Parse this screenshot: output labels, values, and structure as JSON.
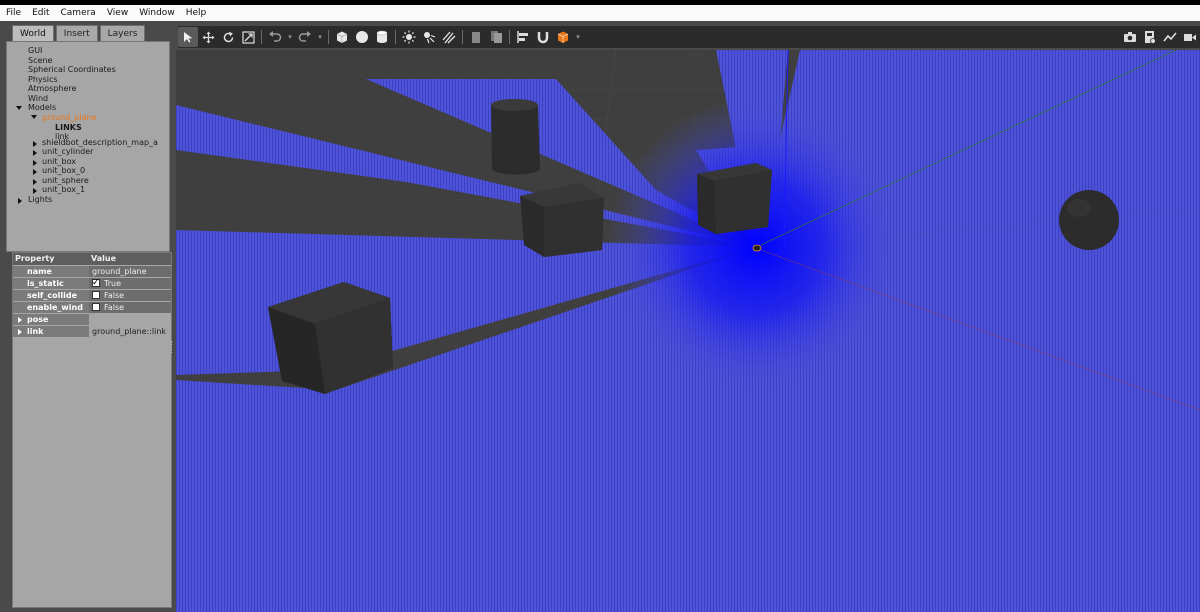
{
  "menubar": {
    "file": "File",
    "edit": "Edit",
    "camera": "Camera",
    "view": "View",
    "window": "Window",
    "help": "Help"
  },
  "tabs": [
    "World",
    "Insert",
    "Layers"
  ],
  "tree": {
    "gui": "GUI",
    "scene": "Scene",
    "spherical": "Spherical Coordinates",
    "physics": "Physics",
    "atmosphere": "Atmosphere",
    "wind": "Wind",
    "models": "Models",
    "ground_plane": "ground_plane",
    "links_header": "LINKS",
    "link": "link",
    "shieldbot": "shieldbot_description_map_a",
    "unit_cylinder": "unit_cylinder",
    "unit_box": "unit_box",
    "unit_box_0": "unit_box_0",
    "unit_sphere": "unit_sphere",
    "unit_box_1": "unit_box_1",
    "lights": "Lights"
  },
  "properties": {
    "header_property": "Property",
    "header_value": "Value",
    "rows": [
      {
        "name": "name",
        "value": "ground_plane"
      },
      {
        "name": "is_static",
        "value": "True",
        "checked": true
      },
      {
        "name": "self_collide",
        "value": "False",
        "checked": false
      },
      {
        "name": "enable_wind",
        "value": "False",
        "checked": false
      },
      {
        "name": "pose",
        "value": ""
      },
      {
        "name": "link",
        "value": "ground_plane::link"
      }
    ]
  },
  "colors": {
    "selected_tree_item": "#e8781a",
    "laser_scan": "#4a4ee0",
    "ground": "#3f3f3f",
    "toolbar": "#2b2b2b"
  },
  "toolbar_icons": [
    "select-arrow-icon",
    "translate-icon",
    "rotate-icon",
    "scale-icon",
    "undo-icon",
    "redo-icon",
    "box-shape-icon",
    "sphere-shape-icon",
    "cylinder-shape-icon",
    "point-light-icon",
    "spot-light-icon",
    "directional-light-icon",
    "copy-icon",
    "paste-icon",
    "align-icon",
    "snap-icon",
    "change-view-icon",
    "screenshot-icon",
    "log-icon",
    "plot-icon",
    "video-record-icon"
  ]
}
